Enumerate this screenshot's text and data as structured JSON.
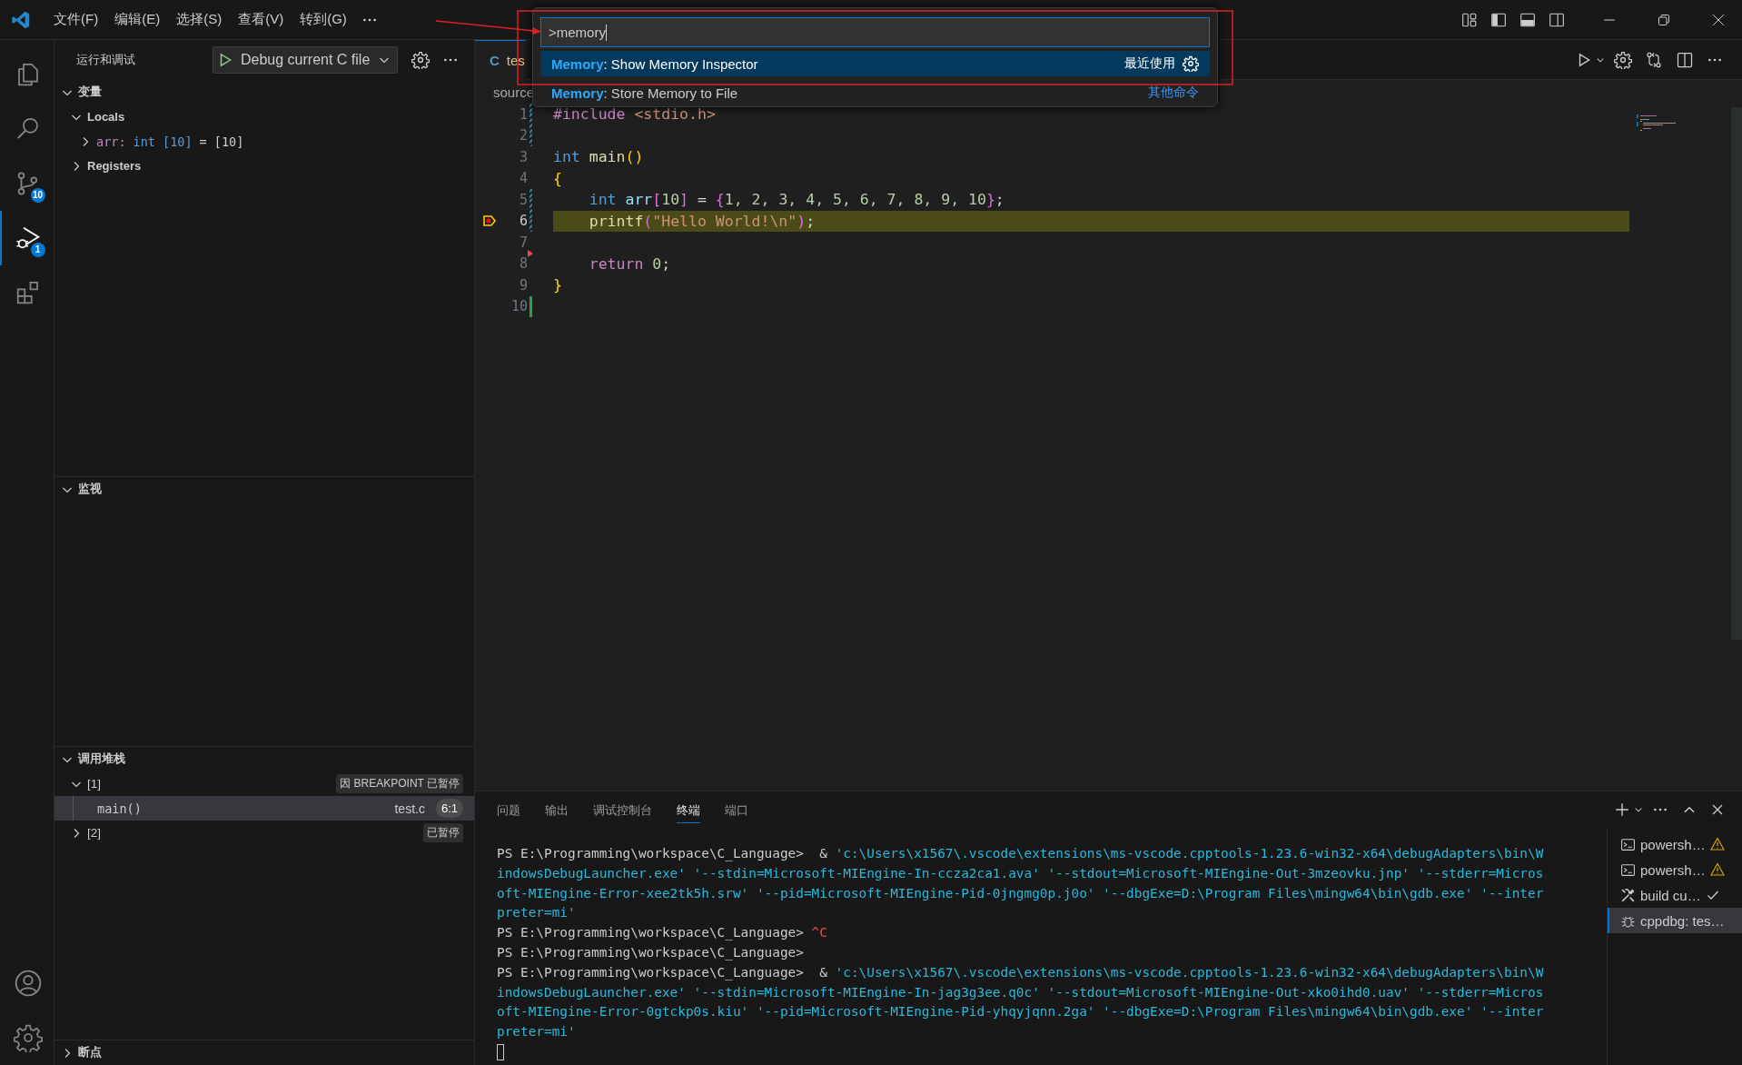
{
  "title_bar": {
    "menus": [
      "文件(F)",
      "编辑(E)",
      "选择(S)",
      "查看(V)",
      "转到(G)"
    ]
  },
  "activity_bar": {
    "items": [
      {
        "kind": "explorer",
        "selected": false
      },
      {
        "kind": "search",
        "selected": false
      },
      {
        "kind": "source_control",
        "selected": false,
        "badge": "10"
      },
      {
        "kind": "run_debug",
        "selected": true,
        "badge": "1"
      },
      {
        "kind": "extensions",
        "selected": false
      }
    ],
    "bottom": [
      {
        "kind": "account"
      },
      {
        "kind": "settings"
      }
    ]
  },
  "sidebar": {
    "title": "运行和调试",
    "debug_config": "Debug current C file",
    "sections": [
      {
        "kind": "variables",
        "title": "变量",
        "expanded": true,
        "scopes": [
          {
            "label": "Locals",
            "expanded": true,
            "children": [
              {
                "name": "arr:",
                "type": "int [10]",
                "value": "= [10]",
                "expanded": false
              }
            ]
          },
          {
            "label": "Registers",
            "expanded": false
          }
        ]
      },
      {
        "kind": "watch",
        "title": "监视",
        "expanded": true
      },
      {
        "kind": "call_stack",
        "title": "调用堆栈",
        "expanded": true,
        "threads": [
          {
            "label": "[1]",
            "expanded": true,
            "status": "因 BREAKPOINT 已暂停",
            "frames": [
              {
                "name": "main()",
                "file": "test.c",
                "position": "6:1",
                "selected": true
              }
            ]
          },
          {
            "label": "[2]",
            "expanded": false,
            "status": "已暂停"
          }
        ]
      },
      {
        "kind": "breakpoints",
        "title": "断点",
        "expanded": false
      }
    ]
  },
  "editor": {
    "tab": {
      "language_badge": "C",
      "label": "tes"
    },
    "breadcrumb": "source",
    "lines": [
      {
        "number": "1",
        "current": false,
        "kind": "modified",
        "tokens": [
          {
            "text": "#include",
            "kind": "control"
          },
          {
            "text": " <stdio.h>",
            "kind": "string"
          }
        ]
      },
      {
        "number": "2",
        "current": false,
        "kind": "modified"
      },
      {
        "number": "3",
        "current": false,
        "kind": "plain",
        "tokens": [
          {
            "text": "int",
            "kind": "keyword"
          },
          {
            "text": " main",
            "kind": "function"
          },
          {
            "text": "()",
            "kind": "bracket1"
          }
        ]
      },
      {
        "number": "4",
        "current": false,
        "kind": "plain",
        "tokens": [
          {
            "text": "{",
            "kind": "bracket1"
          }
        ]
      },
      {
        "number": "5",
        "current": false,
        "kind": "modified",
        "tokens": [
          {
            "text": "    int",
            "kind": "keyword"
          },
          {
            "text": " arr",
            "kind": "variable"
          },
          {
            "text": "[",
            "kind": "bracket2"
          },
          {
            "text": "10",
            "kind": "number"
          },
          {
            "text": "]",
            "kind": "bracket2"
          },
          {
            "text": " =",
            "kind": "plain"
          },
          {
            "text": " {",
            "kind": "bracket2"
          },
          {
            "text": "1, 2, 3, 4, 5, 6, 7, 8, 9, 10",
            "kind": "number"
          },
          {
            "text": "}",
            "kind": "bracket2"
          },
          {
            "text": ";",
            "kind": "plain"
          }
        ]
      },
      {
        "number": "6",
        "current": true,
        "kind": "modified",
        "tokens": [
          {
            "text": "    printf",
            "kind": "function"
          },
          {
            "text": "(",
            "kind": "bracket2"
          },
          {
            "text": "\"Hello World!\\n\"",
            "kind": "string"
          },
          {
            "text": ")",
            "kind": "bracket2"
          },
          {
            "text": ";",
            "kind": "plain"
          }
        ]
      },
      {
        "number": "7",
        "current": false,
        "kind": "plain"
      },
      {
        "number": "8",
        "current": false,
        "kind": "deleted",
        "tokens": [
          {
            "text": "    return",
            "kind": "control"
          },
          {
            "text": " 0",
            "kind": "number"
          },
          {
            "text": ";",
            "kind": "plain"
          }
        ]
      },
      {
        "number": "9",
        "current": false,
        "kind": "plain",
        "tokens": [
          {
            "text": "}",
            "kind": "bracket1"
          }
        ]
      },
      {
        "number": "10",
        "current": false,
        "kind": "added"
      }
    ]
  },
  "command_palette": {
    "value": ">memory",
    "items": [
      {
        "text": "**Memory**: Show Memory Inspector",
        "selected": true,
        "note": "最近使用"
      },
      {
        "text": "**Memory**: Store Memory to File",
        "selected": false,
        "link": "其他命令"
      }
    ]
  },
  "panel": {
    "tabs": [
      {
        "label": "问题",
        "selected": false
      },
      {
        "label": "输出",
        "selected": false
      },
      {
        "label": "调试控制台",
        "selected": false
      },
      {
        "label": "终端",
        "selected": true
      },
      {
        "label": "端口",
        "selected": false
      }
    ],
    "terminal_lines": [
      [
        {
          "text": "PS E:\\Programming\\workspace\\C_Language>  & ",
          "kind": "plain"
        },
        {
          "text": "'c:\\Users\\x1567\\.vscode\\extensions\\ms-vscode.cpptools-1.23.6-win32-x64\\debugAdapters\\bin\\W",
          "kind": "string"
        }
      ],
      [
        {
          "text": "indowsDebugLauncher.exe' '--stdin=Microsoft-MIEngine-In-ccza2ca1.ava' '--stdout=Microsoft-MIEngine-Out-3mzeovku.jnp' '--stderr=Micros",
          "kind": "string"
        }
      ],
      [
        {
          "text": "oft-MIEngine-Error-xee2tk5h.srw' '--pid=Microsoft-MIEngine-Pid-0jngmg0p.j0o' '--dbgExe=D:\\Program Files\\mingw64\\bin\\gdb.exe' '--inter",
          "kind": "string"
        }
      ],
      [
        {
          "text": "preter=mi'",
          "kind": "string"
        }
      ],
      [
        {
          "text": "PS E:\\Programming\\workspace\\C_Language> ",
          "kind": "plain"
        },
        {
          "text": "^C",
          "kind": "error"
        }
      ],
      [
        {
          "text": "PS E:\\Programming\\workspace\\C_Language>",
          "kind": "plain"
        }
      ],
      [
        {
          "text": "PS E:\\Programming\\workspace\\C_Language>  & ",
          "kind": "plain"
        },
        {
          "text": "'c:\\Users\\x1567\\.vscode\\extensions\\ms-vscode.cpptools-1.23.6-win32-x64\\debugAdapters\\bin\\W",
          "kind": "string"
        }
      ],
      [
        {
          "text": "indowsDebugLauncher.exe' '--stdin=Microsoft-MIEngine-In-jag3g3ee.q0c' '--stdout=Microsoft-MIEngine-Out-xko0ihd0.uav' '--stderr=Micros",
          "kind": "string"
        }
      ],
      [
        {
          "text": "oft-MIEngine-Error-0gtckp0s.kiu' '--pid=Microsoft-MIEngine-Pid-yhqyjqnn.2ga' '--dbgExe=D:\\Program Files\\mingw64\\bin\\gdb.exe' '--inter",
          "kind": "string"
        }
      ],
      [
        {
          "text": "preter=mi'",
          "kind": "string"
        }
      ]
    ],
    "terminals": [
      {
        "kind": "shell",
        "label": "powersh…",
        "warning": true,
        "done": false,
        "selected": false
      },
      {
        "kind": "shell",
        "label": "powersh…",
        "warning": true,
        "done": false,
        "selected": false
      },
      {
        "kind": "task",
        "label": "build cu…",
        "warning": false,
        "done": true,
        "selected": false
      },
      {
        "kind": "debug",
        "label": "cppdbg: tes…",
        "warning": false,
        "done": false,
        "selected": true
      }
    ]
  }
}
